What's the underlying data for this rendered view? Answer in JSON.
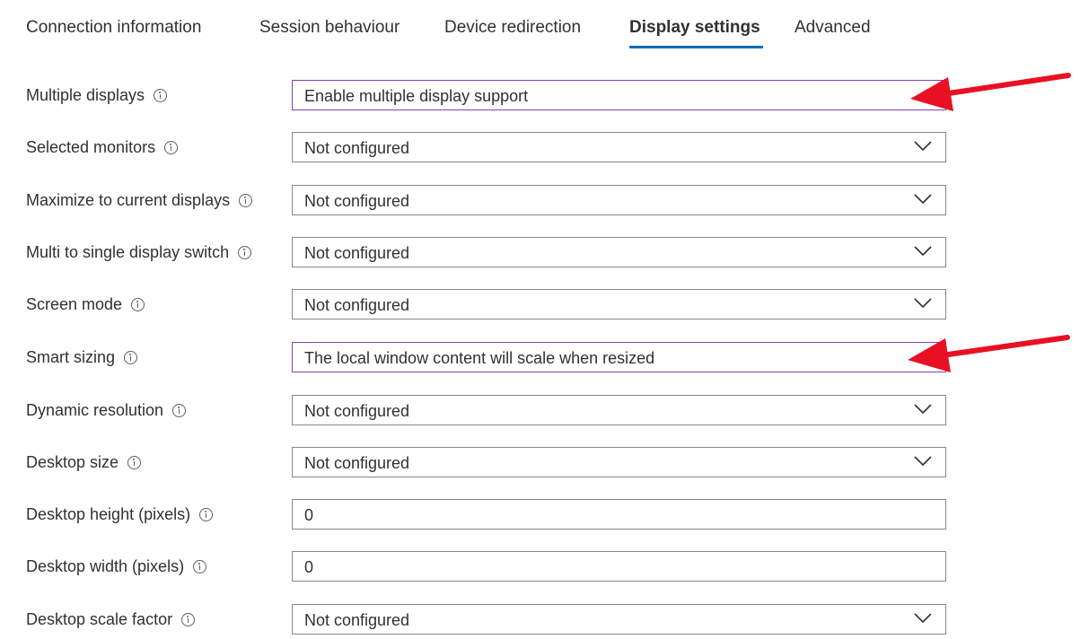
{
  "tabs": [
    {
      "label": "Connection information",
      "active": false
    },
    {
      "label": "Session behaviour",
      "active": false
    },
    {
      "label": "Device redirection",
      "active": false
    },
    {
      "label": "Display settings",
      "active": true
    },
    {
      "label": "Advanced",
      "active": false
    }
  ],
  "settings": [
    {
      "label": "Multiple displays",
      "value": "Enable multiple display support",
      "kind": "dropdown",
      "state": "focused"
    },
    {
      "label": "Selected monitors",
      "value": "Not configured",
      "kind": "dropdown"
    },
    {
      "label": "Maximize to current displays",
      "value": "Not configured",
      "kind": "dropdown"
    },
    {
      "label": "Multi to single display switch",
      "value": "Not configured",
      "kind": "dropdown"
    },
    {
      "label": "Screen mode",
      "value": "Not configured",
      "kind": "dropdown"
    },
    {
      "label": "Smart sizing",
      "value": "The local window content will scale when resized",
      "kind": "dropdown",
      "state": "focused"
    },
    {
      "label": "Dynamic resolution",
      "value": "Not configured",
      "kind": "dropdown"
    },
    {
      "label": "Desktop size",
      "value": "Not configured",
      "kind": "dropdown"
    },
    {
      "label": "Desktop height (pixels)",
      "value": "0",
      "kind": "text"
    },
    {
      "label": "Desktop width (pixels)",
      "value": "0",
      "kind": "text"
    },
    {
      "label": "Desktop scale factor",
      "value": "Not configured",
      "kind": "dropdown"
    }
  ],
  "colors": {
    "accent": "#0f6cbd",
    "focus_border": "#8a3fb5",
    "annotation_arrow": "#e81123"
  },
  "icons": {
    "info": "info-icon",
    "dropdown": "chevron-down-icon",
    "annotation": "red-arrow-icon"
  }
}
